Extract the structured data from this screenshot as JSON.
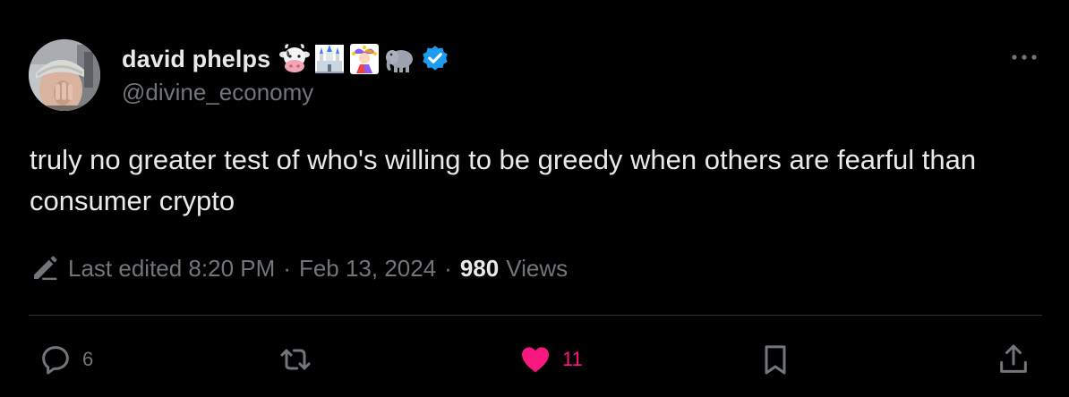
{
  "author": {
    "display_name": "david phelps",
    "handle": "@divine_economy",
    "emojis": [
      "cow-face-icon",
      "castle-icon",
      "jester-icon",
      "elephant-icon"
    ],
    "verified_color": "#1d9bf0"
  },
  "tweet": {
    "text": "truly no greater test of who's willing to be greedy when others are fearful than consumer crypto"
  },
  "meta": {
    "edited_label": "Last edited 8:20 PM",
    "separator": "·",
    "date": "Feb 13, 2024",
    "views_count": "980",
    "views_label": "Views"
  },
  "actions": {
    "replies": "6",
    "reposts": "",
    "likes": "11",
    "like_color": "#f91880"
  },
  "colors": {
    "background": "#000000",
    "text_primary": "#e7e9ea",
    "text_secondary": "#71767b",
    "divider": "#2f3336",
    "accent_blue": "#1d9bf0"
  }
}
